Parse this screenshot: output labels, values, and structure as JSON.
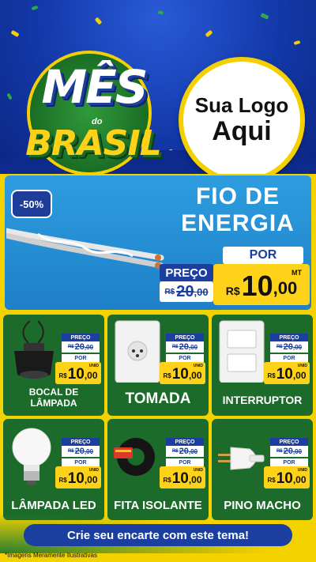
{
  "hero": {
    "title_line1": "MÊS",
    "title_small": "do",
    "title_line2": "BRASIL",
    "logo_line1": "Sua Logo",
    "logo_line2": "Aqui"
  },
  "featured": {
    "discount": "-50%",
    "name_line1": "FIO DE",
    "name_line2": "ENERGIA",
    "por_label": "POR",
    "preco_label": "PREÇO",
    "old_currency": "R$",
    "old_int": "20",
    "old_cents": ",00",
    "new_currency": "R$",
    "new_int": "10",
    "new_cents": ",00",
    "unit": "MT"
  },
  "products": [
    {
      "name": "BOCAL DE LÂMPADA",
      "preco_label": "PREÇO",
      "old_currency": "R$",
      "old_int": "20",
      "old_cents": ",00",
      "por_label": "POR",
      "new_currency": "R$",
      "new_int": "10",
      "new_cents": ",00",
      "unit": "UNID"
    },
    {
      "name": "TOMADA",
      "preco_label": "PREÇO",
      "old_currency": "R$",
      "old_int": "20",
      "old_cents": ",00",
      "por_label": "POR",
      "new_currency": "R$",
      "new_int": "10",
      "new_cents": ",00",
      "unit": "UNID"
    },
    {
      "name": "INTERRUPTOR",
      "preco_label": "PREÇO",
      "old_currency": "R$",
      "old_int": "20",
      "old_cents": ",00",
      "por_label": "POR",
      "new_currency": "R$",
      "new_int": "10",
      "new_cents": ",00",
      "unit": "UNID"
    },
    {
      "name": "LÂMPADA LED",
      "preco_label": "PREÇO",
      "old_currency": "R$",
      "old_int": "20",
      "old_cents": ",00",
      "por_label": "POR",
      "new_currency": "R$",
      "new_int": "10",
      "new_cents": ",00",
      "unit": "UNID"
    },
    {
      "name": "FITA ISOLANTE",
      "preco_label": "PREÇO",
      "old_currency": "R$",
      "old_int": "20",
      "old_cents": ",00",
      "por_label": "POR",
      "new_currency": "R$",
      "new_int": "10",
      "new_cents": ",00",
      "unit": "UNID"
    },
    {
      "name": "PINO MACHO",
      "preco_label": "PREÇO",
      "old_currency": "R$",
      "old_int": "20",
      "old_cents": ",00",
      "por_label": "POR",
      "new_currency": "R$",
      "new_int": "10",
      "new_cents": ",00",
      "unit": "UNID"
    }
  ],
  "footer": {
    "cta": "Crie seu encarte com este tema!",
    "disclaimer": "*Imagens Meramente Ilustrativas"
  },
  "colors": {
    "brand_blue": "#1a3fa0",
    "brand_green": "#1d6b2a",
    "brand_yellow": "#ffd21a"
  }
}
